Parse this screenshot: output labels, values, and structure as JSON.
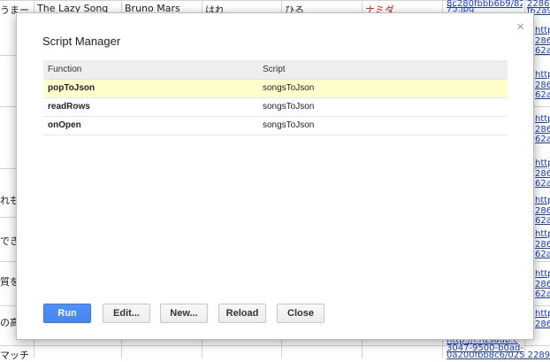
{
  "sheet": {
    "row1": {
      "c0": "うまー",
      "c1": "The Lazy Song",
      "c2": "Bruno Mars",
      "c3": "はれ",
      "c4": "ひる",
      "c5": "ナミダ",
      "c6_line1": "8c280fbbb6b9/829",
      "c6_line2": "75.jpg",
      "c7_line1": "2286-",
      "c7_line2": "f62a9"
    },
    "left_cells": [
      "れも",
      "できの",
      "質を",
      "の高さ",
      "マッチ"
    ],
    "right_links": [
      "http://",
      "286-",
      "62a9"
    ],
    "bottom_link1": "http://i.hzsaub.c",
    "bottom_link2": "3047-9500-b0ad-",
    "bottom_link3": "0a200fbb8c6/025 2289"
  },
  "dialog": {
    "title": "Script Manager",
    "close_glyph": "×",
    "headers": {
      "function": "Function",
      "script": "Script"
    },
    "rows": [
      {
        "function": "popToJson",
        "script": "songsToJson"
      },
      {
        "function": "readRows",
        "script": "songsToJson"
      },
      {
        "function": "onOpen",
        "script": "songsToJson"
      }
    ],
    "buttons": {
      "run": "Run",
      "edit": "Edit...",
      "new": "New...",
      "reload": "Reload",
      "close": "Close"
    }
  }
}
